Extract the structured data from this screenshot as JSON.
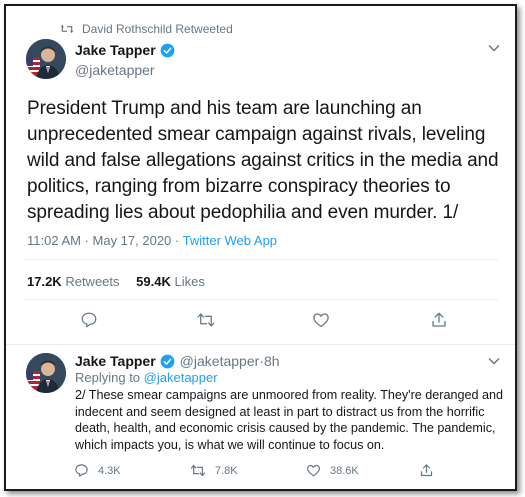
{
  "retweet": {
    "text": "David Rothschild Retweeted"
  },
  "main_tweet": {
    "author_name": "Jake Tapper",
    "author_handle": "@jaketapper",
    "text": "President Trump and his team are launching an unprecedented smear campaign against rivals, leveling wild and false allegations against critics in the media and politics, ranging from bizarre conspiracy theories to spreading lies about pedophilia and even murder. 1/",
    "time": "11:02 AM · May 17, 2020 · ",
    "client": "Twitter Web App",
    "retweets_count": "17.2K",
    "retweets_label": "Retweets",
    "likes_count": "59.4K",
    "likes_label": "Likes"
  },
  "reply_tweet": {
    "author_name": "Jake Tapper",
    "author_handle": "@jaketapper",
    "time_sep": " · ",
    "time": "8h",
    "replying_prefix": "Replying to ",
    "replying_to": "@jaketapper",
    "text": "2/ These smear campaigns are unmoored from reality. They're deranged and indecent and seem designed at least in part to distract us from the horrific death, health, and economic crisis caused by the pandemic.  The pandemic, which impacts you, is what we will continue to focus on.",
    "reply_count": "4.3K",
    "retweet_count": "7.8K",
    "like_count": "38.6K"
  },
  "colors": {
    "accent": "#1da1f2",
    "secondary_text": "#657786",
    "divider": "#e6ecf0"
  },
  "icons": [
    "retweet-icon",
    "verified-badge-icon",
    "chevron-down-icon",
    "reply-icon",
    "like-icon",
    "share-icon"
  ]
}
